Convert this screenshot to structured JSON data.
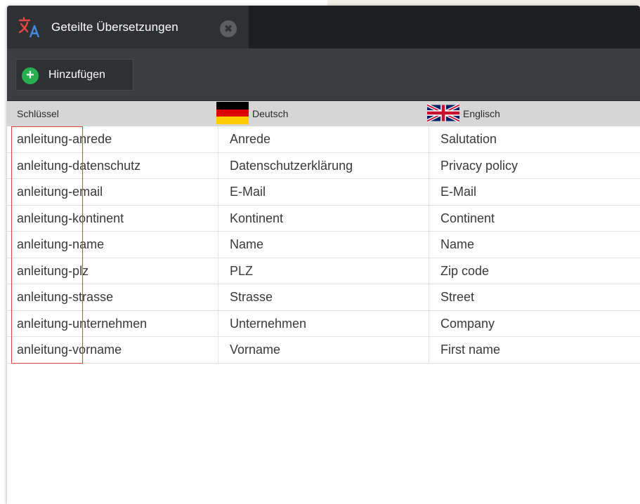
{
  "tab": {
    "title": "Geteilte Übersetzungen",
    "icon": "translate-icon",
    "close_glyph": "✖"
  },
  "toolbar": {
    "add_label": "Hinzufügen",
    "add_glyph": "+"
  },
  "table": {
    "headers": {
      "key": "Schlüssel",
      "de": "Deutsch",
      "en": "Englisch"
    },
    "rows": [
      {
        "key": "anleitung-anrede",
        "de": "Anrede",
        "en": "Salutation"
      },
      {
        "key": "anleitung-datenschutz",
        "de": "Datenschutzerklärung",
        "en": "Privacy policy"
      },
      {
        "key": "anleitung-email",
        "de": "E-Mail",
        "en": "E-Mail"
      },
      {
        "key": "anleitung-kontinent",
        "de": "Kontinent",
        "en": "Continent"
      },
      {
        "key": "anleitung-name",
        "de": "Name",
        "en": "Name"
      },
      {
        "key": "anleitung-plz",
        "de": "PLZ",
        "en": "Zip code"
      },
      {
        "key": "anleitung-strasse",
        "de": "Strasse",
        "en": "Street"
      },
      {
        "key": "anleitung-unternehmen",
        "de": "Unternehmen",
        "en": "Company"
      },
      {
        "key": "anleitung-vorname",
        "de": "Vorname",
        "en": "First name"
      }
    ]
  },
  "colors": {
    "accent_red": "#e0443f",
    "add_green": "#27ae4f",
    "tabbar_bg": "#1c1e21",
    "toolbar_bg": "#3b3d41"
  }
}
